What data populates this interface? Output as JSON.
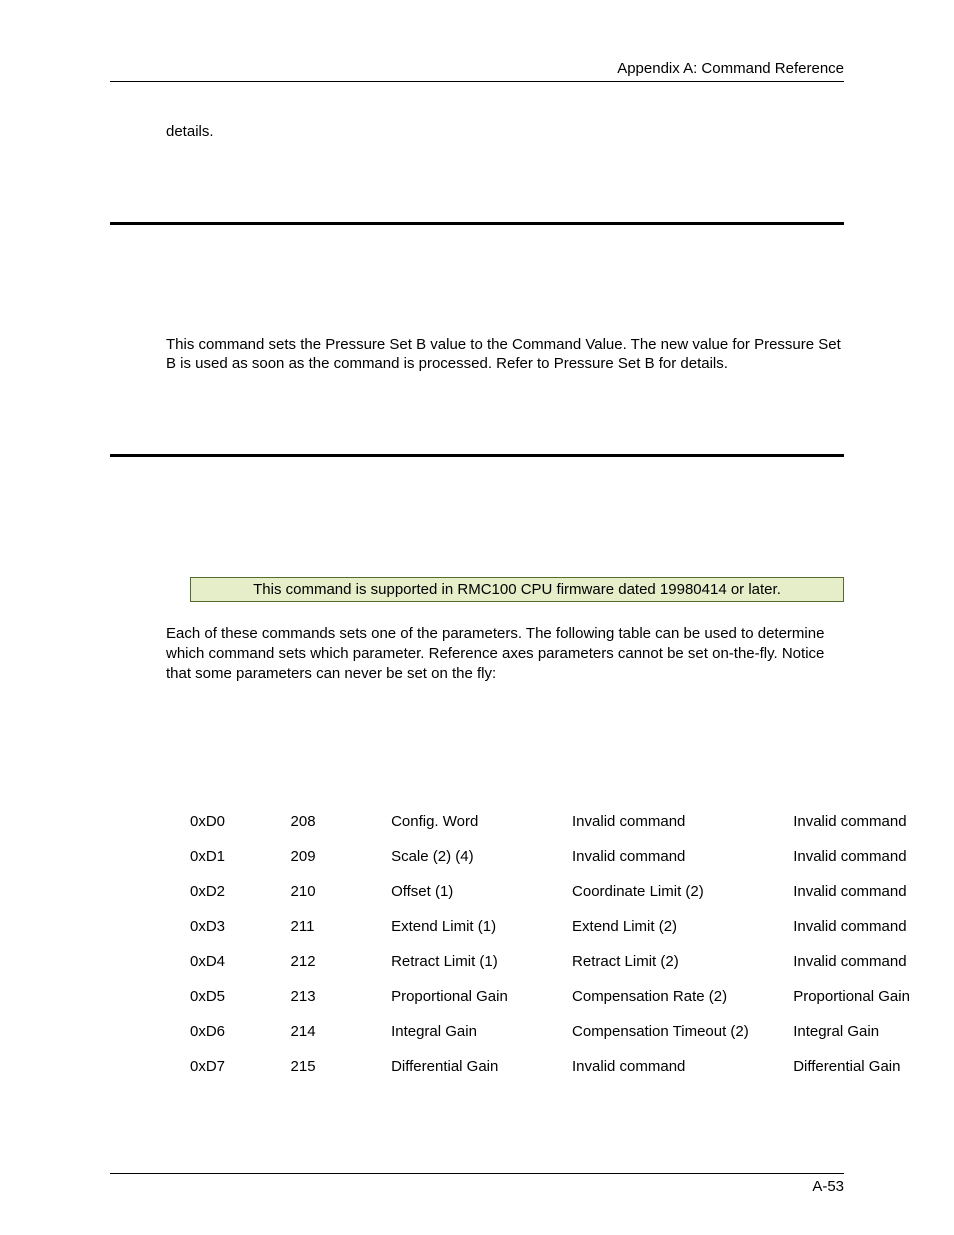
{
  "header": {
    "title": "Appendix A:  Command Reference"
  },
  "sections": {
    "details_word": "details.",
    "pressure_set_b_desc": "This command sets the Pressure Set B value to the Command Value. The new value for Pressure Set B is used as soon as the command is processed. Refer to Pressure Set B for details.",
    "firmware_note": "This command is supported in RMC100 CPU firmware dated 19980414 or later.",
    "param_intro": "Each of these commands sets one of the parameters. The following table can be used to determine which command sets which parameter. Reference axes parameters cannot be set on-the-fly. Notice that some parameters can never be set on the fly:"
  },
  "table": {
    "rows": [
      {
        "hex": "0xD0",
        "dec": "208",
        "c3": "Config. Word",
        "c4": "Invalid command",
        "c5": "Invalid command"
      },
      {
        "hex": "0xD1",
        "dec": "209",
        "c3": "Scale (2) (4)",
        "c4": "Invalid command",
        "c5": "Invalid command"
      },
      {
        "hex": "0xD2",
        "dec": "210",
        "c3": "Offset (1)",
        "c4": "Coordinate Limit (2)",
        "c5": "Invalid command"
      },
      {
        "hex": "0xD3",
        "dec": "211",
        "c3": "Extend Limit (1)",
        "c4": "Extend Limit (2)",
        "c5": "Invalid command"
      },
      {
        "hex": "0xD4",
        "dec": "212",
        "c3": "Retract Limit (1)",
        "c4": "Retract Limit (2)",
        "c5": "Invalid command"
      },
      {
        "hex": "0xD5",
        "dec": "213",
        "c3": "Proportional Gain",
        "c4": "Compensation Rate (2)",
        "c5": "Proportional Gain"
      },
      {
        "hex": "0xD6",
        "dec": "214",
        "c3": "Integral Gain",
        "c4": "Compensation Timeout (2)",
        "c5": "Integral Gain"
      },
      {
        "hex": "0xD7",
        "dec": "215",
        "c3": "Differential Gain",
        "c4": "Invalid command",
        "c5": "Differential Gain"
      }
    ]
  },
  "footer": {
    "page_num": "A-53"
  }
}
